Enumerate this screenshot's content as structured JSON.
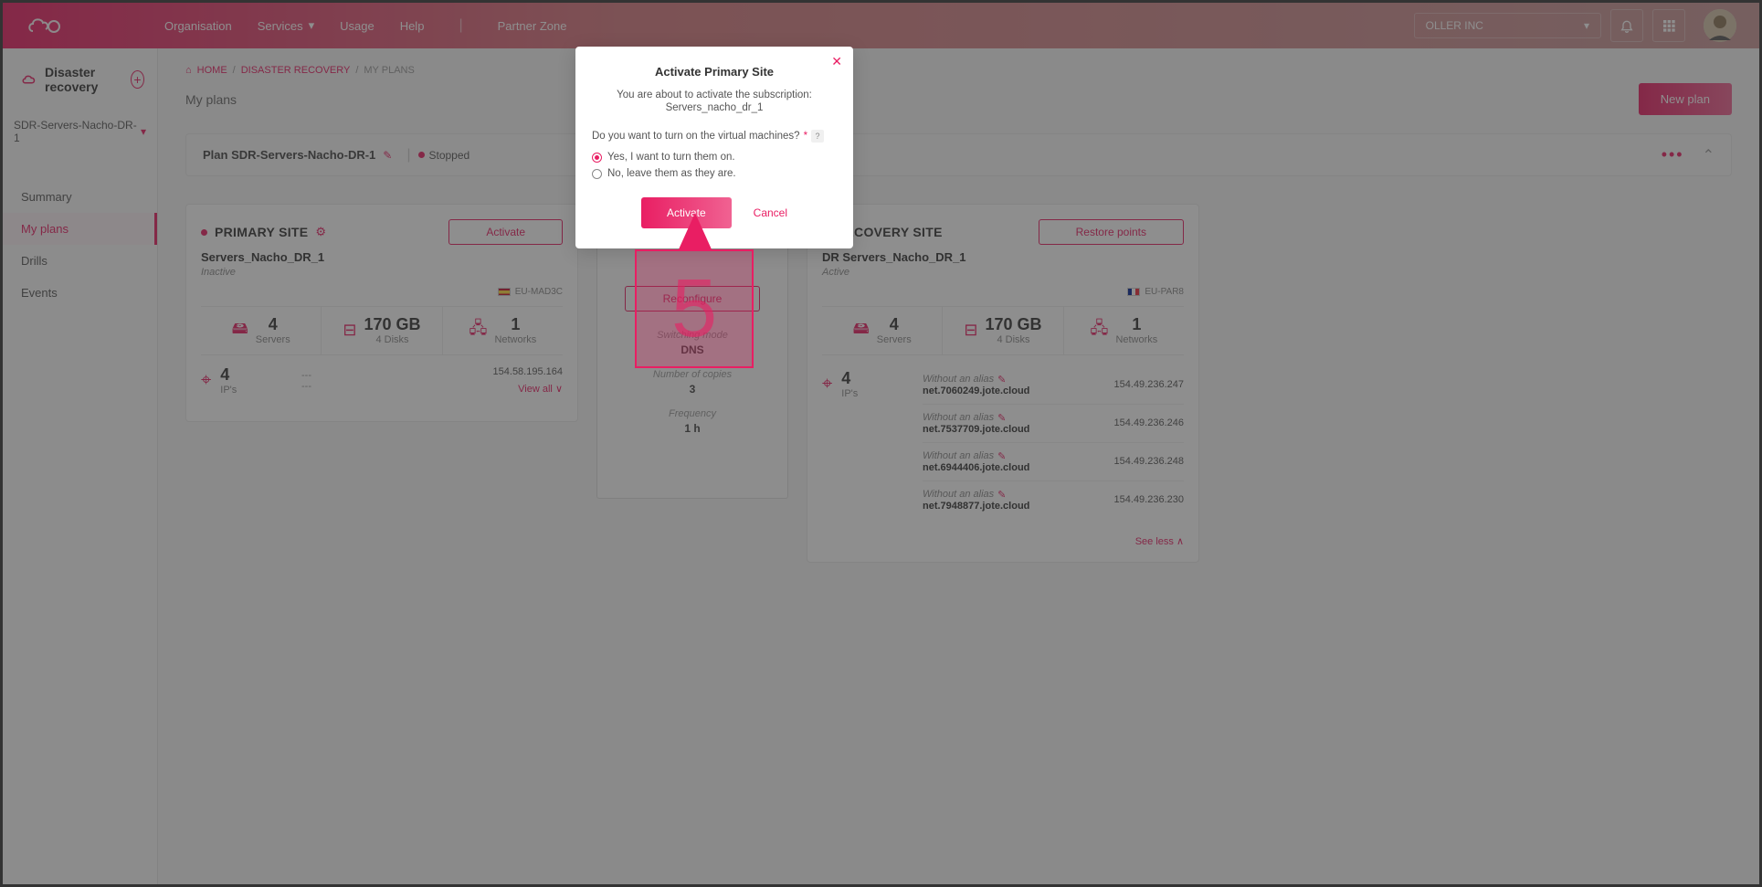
{
  "nav": {
    "org": "Organisation",
    "services": "Services",
    "usage": "Usage",
    "help": "Help",
    "partner": "Partner Zone",
    "account": "OLLER INC"
  },
  "sidebar": {
    "title": "Disaster recovery",
    "select": "SDR-Servers-Nacho-DR-1",
    "items": [
      "Summary",
      "My plans",
      "Drills",
      "Events"
    ]
  },
  "breadcrumb": {
    "home": "HOME",
    "dr": "DISASTER RECOVERY",
    "myplans": "MY PLANS"
  },
  "page_title": "My plans",
  "new_plan": "New plan",
  "plan_bar": {
    "name": "Plan SDR-Servers-Nacho-DR-1",
    "status": "Stopped"
  },
  "primary": {
    "title": "PRIMARY SITE",
    "btn": "Activate",
    "sub": "Servers_Nacho_DR_1",
    "status": "Inactive",
    "region": "EU-MAD3C",
    "servers_num": "4",
    "servers_lbl": "Servers",
    "storage_num": "170 GB",
    "storage_lbl": "4 Disks",
    "net_num": "1",
    "net_lbl": "Networks",
    "ips_num": "4",
    "ips_lbl": "IP's",
    "dash1": "---",
    "dash2": "---",
    "ip": "154.58.195.164",
    "viewall": "View all"
  },
  "middle": {
    "btn": "Reconfigure",
    "mode_lbl": "Switching mode",
    "mode_val": "DNS",
    "copies_lbl": "Number of copies",
    "copies_val": "3",
    "freq_lbl": "Frequency",
    "freq_val": "1 h"
  },
  "recovery": {
    "title": "RECOVERY SITE",
    "btn": "Restore points",
    "sub": "DR Servers_Nacho_DR_1",
    "status": "Active",
    "region": "EU-PAR8",
    "servers_num": "4",
    "servers_lbl": "Servers",
    "storage_num": "170 GB",
    "storage_lbl": "4 Disks",
    "net_num": "1",
    "net_lbl": "Networks",
    "ips_num": "4",
    "ips_lbl": "IP's",
    "alias_txt": "Without an alias",
    "nets": [
      {
        "domain": "net.7060249.jote.cloud",
        "ip": "154.49.236.247"
      },
      {
        "domain": "net.7537709.jote.cloud",
        "ip": "154.49.236.246"
      },
      {
        "domain": "net.6944406.jote.cloud",
        "ip": "154.49.236.248"
      },
      {
        "domain": "net.7948877.jote.cloud",
        "ip": "154.49.236.230"
      }
    ],
    "seeless": "See less"
  },
  "modal": {
    "title": "Activate Primary Site",
    "msg": "You are about to activate the subscription:",
    "sub": "Servers_nacho_dr_1",
    "question": "Do you want to turn on the virtual machines?",
    "opt1": "Yes, I want to turn them on.",
    "opt2": "No, leave them as they are.",
    "activate": "Activate",
    "cancel": "Cancel"
  },
  "annotation": "5"
}
